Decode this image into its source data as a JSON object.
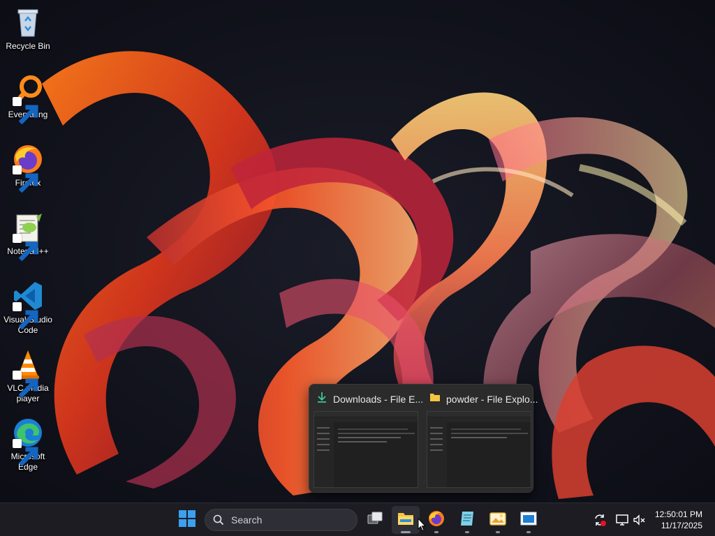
{
  "desktop": {
    "icons": [
      {
        "label": "Recycle Bin",
        "icon": "recycle-bin-icon",
        "shortcut": false
      },
      {
        "label": "Everything",
        "icon": "everything-search-icon",
        "shortcut": true
      },
      {
        "label": "Firefox",
        "icon": "firefox-icon",
        "shortcut": true
      },
      {
        "label": "Notepad++",
        "icon": "notepad-plus-plus-icon",
        "shortcut": true
      },
      {
        "label": "Visual Studio\nCode",
        "icon": "vscode-icon",
        "shortcut": true
      },
      {
        "label": "VLC media\nplayer",
        "icon": "vlc-icon",
        "shortcut": true
      },
      {
        "label": "Microsoft\nEdge",
        "icon": "edge-icon",
        "shortcut": true
      }
    ]
  },
  "preview": {
    "windows": [
      {
        "title": "Downloads - File E...",
        "icon": "download-arrow-icon"
      },
      {
        "title": "powder - File Explo...",
        "icon": "folder-icon"
      }
    ]
  },
  "taskbar": {
    "search_placeholder": "Search",
    "apps": [
      {
        "name": "start",
        "icon": "windows-start-icon"
      },
      {
        "name": "task-view",
        "icon": "task-view-icon"
      },
      {
        "name": "file-explorer",
        "icon": "folder-icon",
        "active": true
      },
      {
        "name": "firefox",
        "icon": "firefox-icon"
      },
      {
        "name": "notepad",
        "icon": "notepad-icon"
      },
      {
        "name": "image-viewer",
        "icon": "photo-viewer-icon"
      },
      {
        "name": "window-app",
        "icon": "window-app-icon"
      }
    ],
    "tray": [
      "sync-error-icon",
      "network-icon",
      "volume-muted-icon"
    ],
    "clock": {
      "time": "12:50:01 PM",
      "date": "11/17/2025"
    }
  },
  "colors": {
    "taskbar": "#1c1c22",
    "accent": "#0078d4",
    "wallpaper_base": "#0d0f17"
  }
}
